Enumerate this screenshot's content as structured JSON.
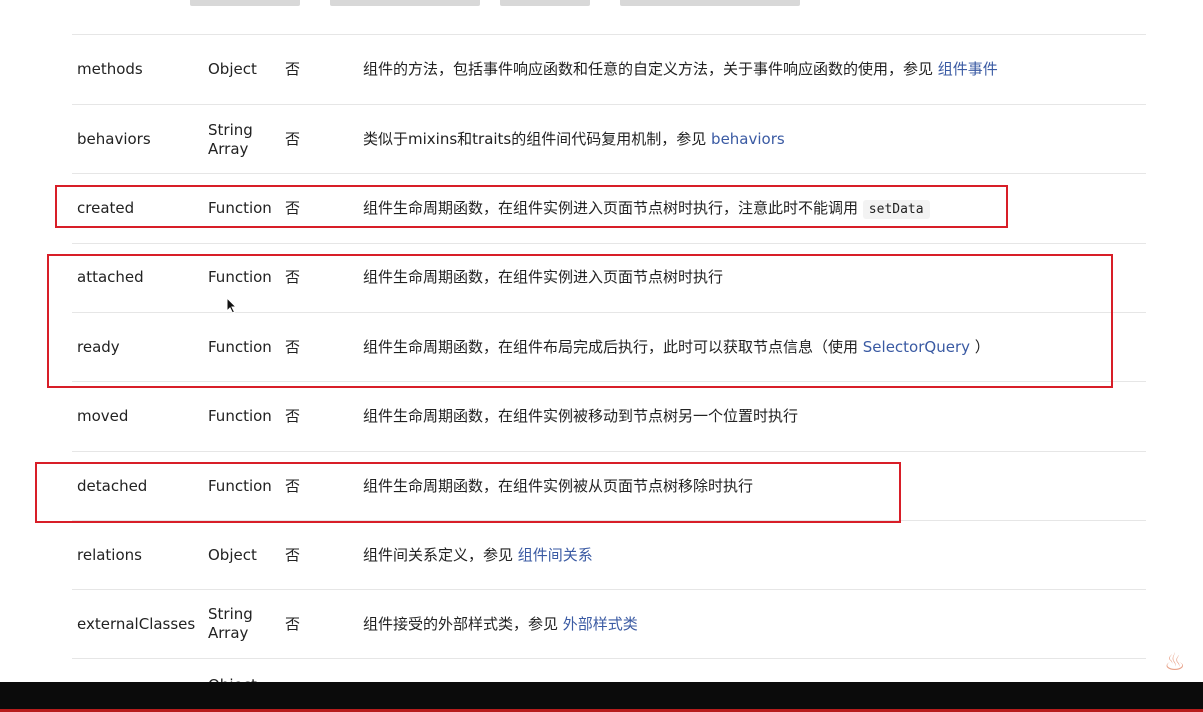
{
  "rows": [
    {
      "name": "methods",
      "type": "Object",
      "required": "否",
      "desc": "组件的方法，包括事件响应函数和任意的自定义方法，关于事件响应函数的使用，参见",
      "link": "组件事件"
    },
    {
      "name": "behaviors",
      "type_line1": "String",
      "type_line2": "Array",
      "required": "否",
      "desc": "类似于mixins和traits的组件间代码复用机制，参见",
      "link": "behaviors"
    },
    {
      "name": "created",
      "type": "Function",
      "required": "否",
      "desc": "组件生命周期函数，在组件实例进入页面节点树时执行，注意此时不能调用",
      "code": "setData"
    },
    {
      "name": "attached",
      "type": "Function",
      "required": "否",
      "desc": "组件生命周期函数，在组件实例进入页面节点树时执行"
    },
    {
      "name": "ready",
      "type": "Function",
      "required": "否",
      "desc": "组件生命周期函数，在组件布局完成后执行，此时可以获取节点信息（使用 ",
      "link": "SelectorQuery",
      "desc_after": " ）"
    },
    {
      "name": "moved",
      "type": "Function",
      "required": "否",
      "desc": "组件生命周期函数，在组件实例被移动到节点树另一个位置时执行"
    },
    {
      "name": "detached",
      "type": "Function",
      "required": "否",
      "desc": "组件生命周期函数，在组件实例被从页面节点树移除时执行"
    },
    {
      "name": "relations",
      "type": "Object",
      "required": "否",
      "desc": "组件间关系定义，参见",
      "link": "组件间关系"
    },
    {
      "name": "externalClasses",
      "type_line1": "String",
      "type_line2": "Array",
      "required": "否",
      "desc": "组件接受的外部样式类，参见",
      "link": "外部样式类"
    },
    {
      "type_partial": "Object"
    }
  ],
  "colors": {
    "link": "#3a5aa3",
    "highlight": "#d81e28",
    "divider": "#e6e6e6"
  }
}
